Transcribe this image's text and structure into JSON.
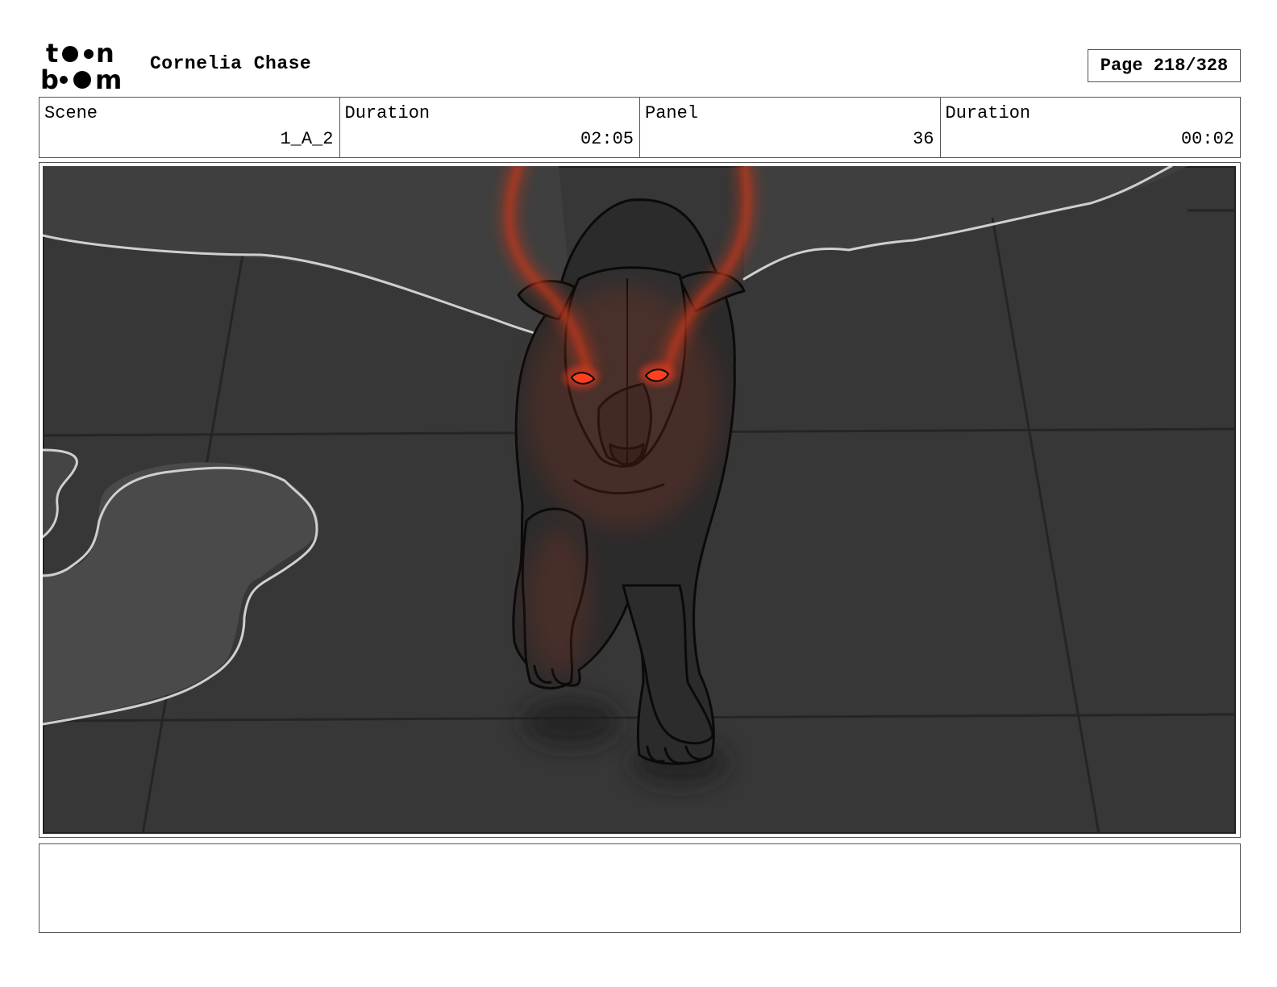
{
  "header": {
    "logo_text": "toonboom",
    "project_title": "Cornelia Chase",
    "page_label": "Page 218/328"
  },
  "info": {
    "scene_label": "Scene",
    "scene_value": "1_A_2",
    "scene_duration_label": "Duration",
    "scene_duration_value": "02:05",
    "panel_label": "Panel",
    "panel_value": "36",
    "panel_duration_label": "Duration",
    "panel_duration_value": "00:02"
  },
  "panel": {
    "colors": {
      "background": "#383838",
      "upper_wall": "#404040",
      "light_patch": "#4a4a4a",
      "outline": "#d0d0d0",
      "creature": "#2b2b2b",
      "glow": "#c0381e",
      "eyes": "#ff3a1a"
    }
  },
  "notes": {
    "text": ""
  }
}
